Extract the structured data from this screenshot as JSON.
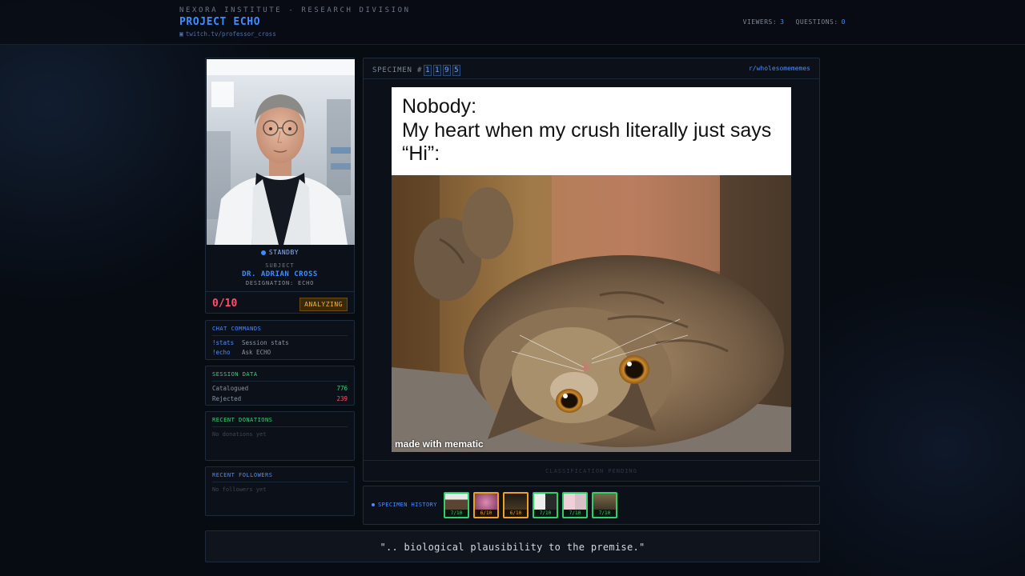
{
  "header": {
    "org": "NEXORA INSTITUTE - RESEARCH DIVISION",
    "project": "PROJECT ECHO",
    "channel": "twitch.tv/professor_cross",
    "viewers_label": "VIEWERS:",
    "viewers": "3",
    "questions_label": "QUESTIONS:",
    "questions": "0"
  },
  "profile": {
    "status": "STANDBY",
    "subject_label": "SUBJECT",
    "name": "DR. ADRIAN CROSS",
    "designation": "DESIGNATION: ECHO",
    "score": "0/10",
    "badge": "ANALYZING"
  },
  "commands": {
    "title": "CHAT COMMANDS",
    "items": [
      {
        "cmd": "!stats",
        "desc": "Session stats"
      },
      {
        "cmd": "!echo",
        "desc": "Ask ECHO"
      }
    ]
  },
  "session": {
    "title": "SESSION DATA",
    "catalogued_label": "Catalogued",
    "catalogued": "776",
    "rejected_label": "Rejected",
    "rejected": "239"
  },
  "donations": {
    "title": "RECENT DONATIONS",
    "empty": "No donations yet"
  },
  "followers": {
    "title": "RECENT FOLLOWERS",
    "empty": "No followers yet"
  },
  "specimen": {
    "label": "SPECIMEN #",
    "digits": [
      "1",
      "1",
      "9",
      "5"
    ],
    "subreddit": "r/wholesomememes",
    "meme_line1": "Nobody:",
    "meme_line2": "My heart when my crush literally just says “Hi”:",
    "watermark": "made with mematic",
    "footer": "CLASSIFICATION PENDING"
  },
  "history": {
    "label": "SPECIMEN HISTORY",
    "items": [
      {
        "score": "7/10",
        "status": "green"
      },
      {
        "score": "6/10",
        "status": "amber"
      },
      {
        "score": "6/10",
        "status": "amber"
      },
      {
        "score": "7/10",
        "status": "green"
      },
      {
        "score": "7/10",
        "status": "green"
      },
      {
        "score": "7/10",
        "status": "green"
      }
    ]
  },
  "quote": "\".. biological plausibility to the premise.\"",
  "colors": {
    "accent": "#3e8dff",
    "score_red": "#ff4f6a",
    "success_green": "#3bd07a",
    "warning_amber": "#f0a020",
    "background": "#070b12"
  }
}
